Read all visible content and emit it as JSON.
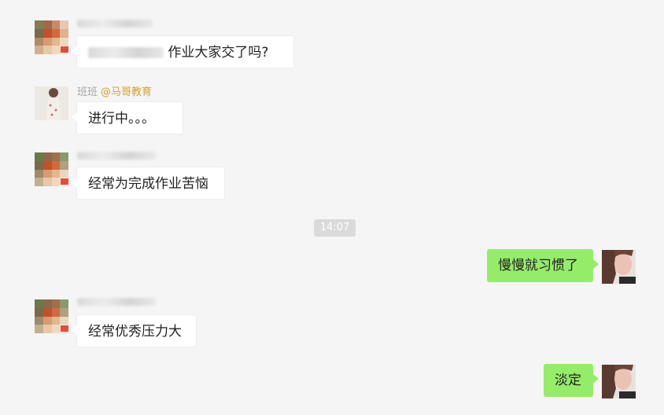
{
  "chat": {
    "messages": [
      {
        "side": "in",
        "sender": "",
        "text": "作业大家交了吗?"
      },
      {
        "side": "in",
        "sender": "班班",
        "sender_tag": "@马哥教育",
        "text": "进行中。。。"
      },
      {
        "side": "in",
        "sender": "",
        "text": "经常为完成作业苦恼"
      },
      {
        "side": "out",
        "text": "慢慢就习惯了"
      },
      {
        "side": "in",
        "sender": "",
        "text": "经常优秀压力大"
      },
      {
        "side": "out",
        "text": "淡定"
      }
    ],
    "timestamp": "14:07"
  },
  "colors": {
    "background": "#f5f5f5",
    "incoming_bubble": "#ffffff",
    "outgoing_bubble": "#95ec69",
    "sender_tag": "#d6a22c",
    "timestamp_bg": "#dadada"
  }
}
